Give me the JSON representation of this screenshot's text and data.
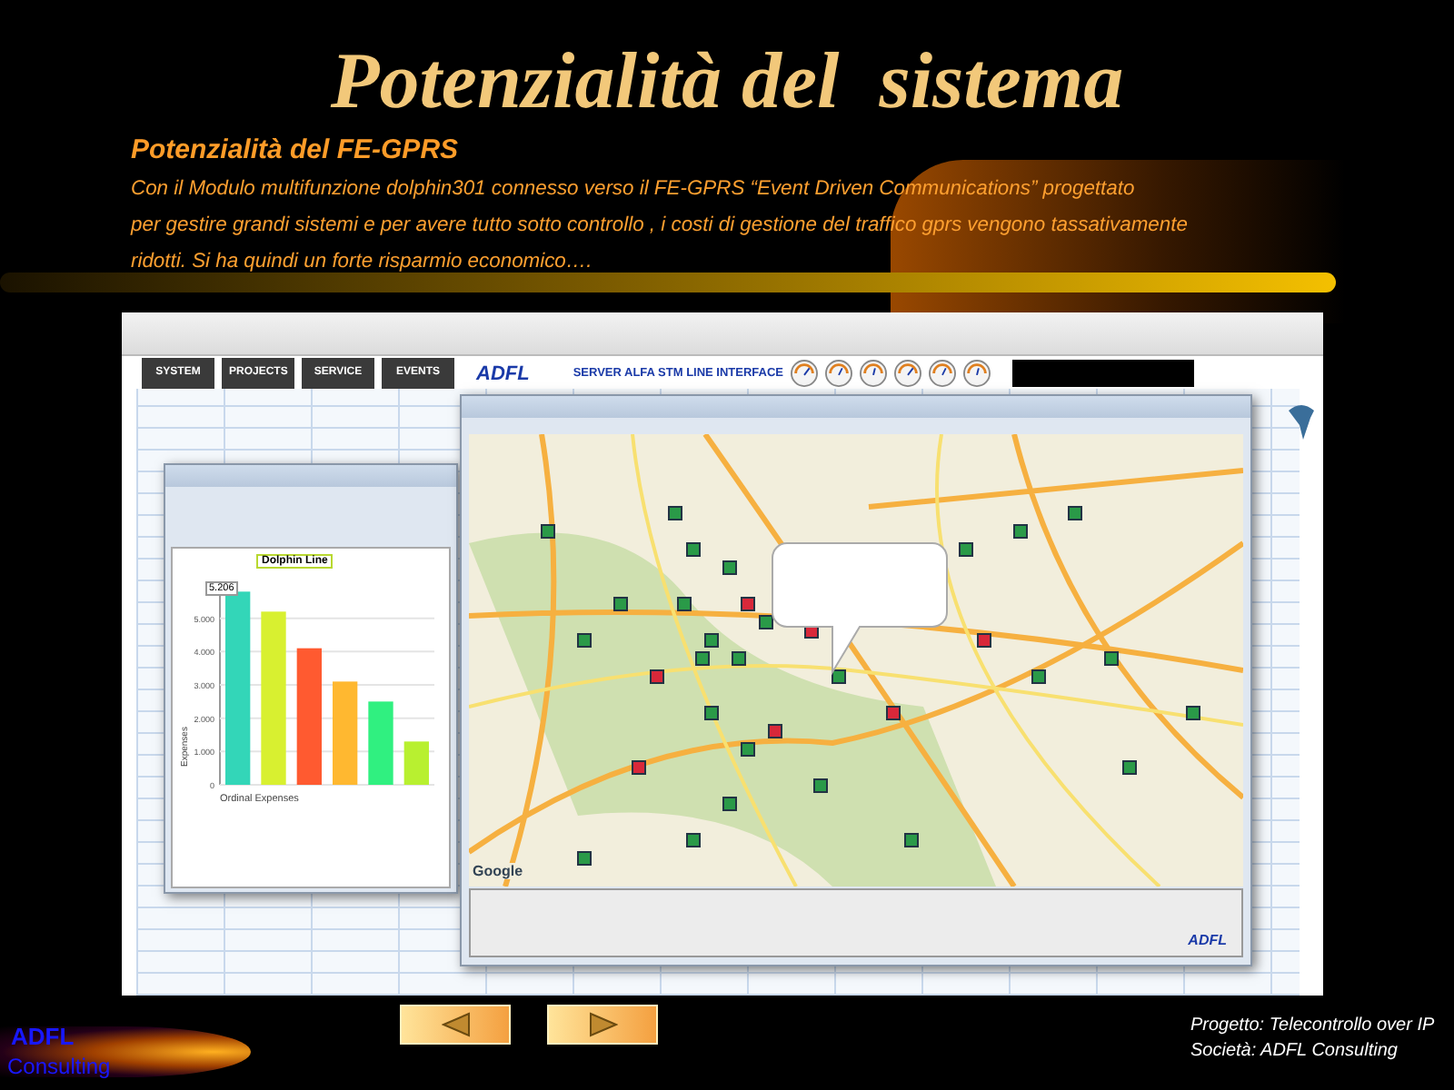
{
  "slide": {
    "title": "Potenzialità del  sistema",
    "subtitle": "Potenzialità del FE-GPRS",
    "body_lines": [
      "Con il Modulo multifunzione dolphin301 connesso verso il FE-GPRS “Event Driven Communications” progettato",
      "per gestire grandi sistemi e per avere tutto sotto controllo , i costi di gestione del traffico gprs vengono tassativamente",
      "ridotti. Si ha quindi un forte risparmio economico…."
    ]
  },
  "screenshot": {
    "nav_tabs": [
      {
        "label": "SYSTEM"
      },
      {
        "label": "PROJECTS"
      },
      {
        "label": "SERVICE"
      },
      {
        "label": "EVENTS"
      }
    ],
    "logo": "ADFL",
    "header_title": "SERVER ALFA STM LINE INTERFACE",
    "chart_window": {
      "tooltip_title": "Dolphin Line",
      "tooltip_value": "5.206",
      "chart_data": {
        "type": "bar",
        "xlabel": "Ordinal Expenses",
        "ylabel": "Expenses",
        "values": [
          5800,
          5200,
          4100,
          3100,
          2500,
          1300
        ],
        "grid": true,
        "colors": [
          "#33d6b8",
          "#d8f030",
          "#ff5a30",
          "#ffb830",
          "#30f080",
          "#b8f030"
        ],
        "ylim": [
          0,
          6000
        ],
        "yticks": [
          {
            "value": 0,
            "label": "0"
          },
          {
            "value": 1000,
            "label": "1.000"
          },
          {
            "value": 2000,
            "label": "2.000"
          },
          {
            "value": 3000,
            "label": "3.000"
          },
          {
            "value": 4000,
            "label": "4.000"
          },
          {
            "value": 5000,
            "label": "5.000"
          }
        ]
      }
    },
    "map_window": {
      "map_logo": "Google",
      "logo": "ADFL"
    }
  },
  "nav_buttons": [
    {
      "kind": "previous"
    },
    {
      "kind": "next"
    }
  ],
  "footer": {
    "logo_line1": "ADFL",
    "logo_line2": "Consulting",
    "project": "Progetto: Telecontrollo over IP",
    "company": "Società: ADFL Consulting"
  }
}
